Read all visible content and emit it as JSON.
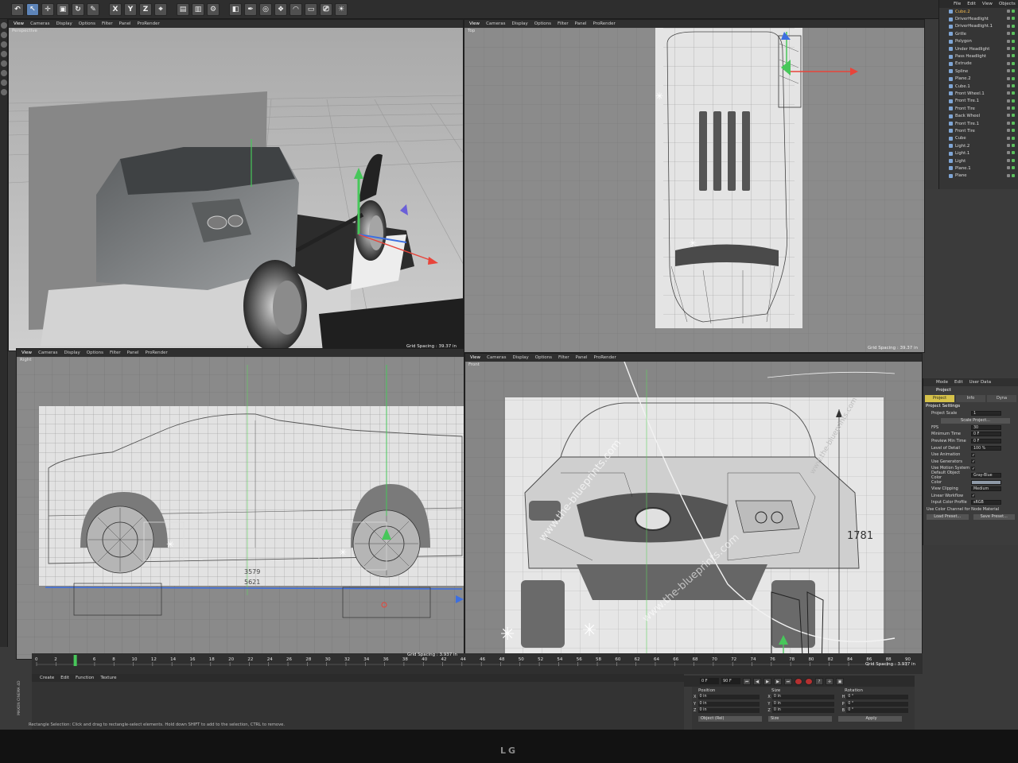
{
  "toolbar": {
    "axis_x": "X",
    "axis_y": "Y",
    "axis_z": "Z"
  },
  "viewports": {
    "perspective": {
      "menu": [
        "View",
        "Cameras",
        "Display",
        "Options",
        "Filter",
        "Panel",
        "ProRender"
      ],
      "name": "Perspective",
      "grid_spacing": "Grid Spacing : 39.37 in"
    },
    "top": {
      "menu": [
        "View",
        "Cameras",
        "Display",
        "Options",
        "Filter",
        "Panel",
        "ProRender"
      ],
      "name": "Top",
      "grid_spacing": "Grid Spacing : 39.37 in"
    },
    "right": {
      "menu": [
        "View",
        "Cameras",
        "Display",
        "Options",
        "Filter",
        "Panel",
        "ProRender"
      ],
      "name": "Right",
      "grid_spacing": "Grid Spacing : 3.937 in",
      "dim_1": "3579",
      "dim_2": "5621"
    },
    "front": {
      "menu": [
        "View",
        "Cameras",
        "Display",
        "Options",
        "Filter",
        "Panel",
        "ProRender"
      ],
      "name": "Front",
      "grid_spacing": "Grid Spacing : 3.937 in",
      "dim_height": "1781",
      "watermark": "www.the-blueprints.com"
    }
  },
  "object_manager": {
    "menu": [
      "File",
      "Edit",
      "View",
      "Objects"
    ],
    "objects": [
      {
        "name": "Cube.2",
        "selected": true
      },
      {
        "name": "DriverHeadlight",
        "selected": false
      },
      {
        "name": "DriverHeadlight.1",
        "selected": false
      },
      {
        "name": "Grille",
        "selected": false
      },
      {
        "name": "Polygon",
        "selected": false
      },
      {
        "name": "Under Headlight",
        "selected": false
      },
      {
        "name": "Pass Headlight",
        "selected": false
      },
      {
        "name": "Extrude",
        "selected": false
      },
      {
        "name": "Spline",
        "selected": false
      },
      {
        "name": "Plane.2",
        "selected": false
      },
      {
        "name": "Cube.1",
        "selected": false
      },
      {
        "name": "Front Wheel.1",
        "selected": false
      },
      {
        "name": "Front Tire.1",
        "selected": false
      },
      {
        "name": "Front Tire",
        "selected": false
      },
      {
        "name": "Back Wheel",
        "selected": false
      },
      {
        "name": "Front Tire.1",
        "selected": false
      },
      {
        "name": "Front Tire",
        "selected": false
      },
      {
        "name": "Cube",
        "selected": false
      },
      {
        "name": "Light.2",
        "selected": false
      },
      {
        "name": "Light.1",
        "selected": false
      },
      {
        "name": "Light",
        "selected": false
      },
      {
        "name": "Plane.1",
        "selected": false
      },
      {
        "name": "Plane",
        "selected": false
      }
    ]
  },
  "attributes": {
    "menu": [
      "Mode",
      "Edit",
      "User Data"
    ],
    "title": "Project",
    "tabs": [
      "Project Settings",
      "Info",
      "Dyna"
    ],
    "section": "Project Settings",
    "project_scale_label": "Project Scale",
    "project_scale_value": "1",
    "scale_button": "Scale Project...",
    "fps_label": "FPS",
    "fps_value": "30",
    "min_time_label": "Minimum Time",
    "min_time_value": "0 F",
    "preview_min_label": "Preview Min Time",
    "preview_min_value": "0 F",
    "lod_label": "Level of Detail",
    "lod_value": "100 %",
    "use_animation_label": "Use Animation",
    "use_generators_label": "Use Generators",
    "use_motion_label": "Use Motion System",
    "default_color_label": "Default Object Color",
    "default_color_value": "Gray-Blue",
    "color_label": "Color",
    "view_clipping_label": "View Clipping",
    "view_clipping_value": "Medium",
    "linear_workflow_label": "Linear Workflow",
    "input_color_label": "Input Color Profile",
    "input_color_value": "sRGB",
    "node_material_label": "Use Color Channel for Node Material",
    "load_preset": "Load Preset...",
    "save_preset": "Save Preset..."
  },
  "timeline": {
    "ticks": [
      "0",
      "2",
      "4",
      "6",
      "8",
      "10",
      "12",
      "14",
      "16",
      "18",
      "20",
      "22",
      "24",
      "26",
      "28",
      "30",
      "32",
      "34",
      "36",
      "38",
      "40",
      "42",
      "44",
      "46",
      "48",
      "50",
      "52",
      "54",
      "56",
      "58",
      "60",
      "62",
      "64",
      "66",
      "68",
      "70",
      "72",
      "74",
      "76",
      "78",
      "80",
      "82",
      "84",
      "86",
      "88",
      "90"
    ],
    "current_frame": "0 F",
    "end_frame": "90 F"
  },
  "material_manager": {
    "menu": [
      "Create",
      "Edit",
      "Function",
      "Texture"
    ]
  },
  "coordinates": {
    "headers": [
      "Position",
      "Size",
      "Rotation"
    ],
    "rows": [
      {
        "axis": "X",
        "pos": "0 in",
        "size": "0 in",
        "rot_axis": "H",
        "rot": "0 °"
      },
      {
        "axis": "Y",
        "pos": "0 in",
        "size": "0 in",
        "rot_axis": "P",
        "rot": "0 °"
      },
      {
        "axis": "Z",
        "pos": "0 in",
        "size": "0 in",
        "rot_axis": "B",
        "rot": "0 °"
      }
    ],
    "mode": "Object (Rel)",
    "size_mode": "Size",
    "apply": "Apply"
  },
  "status_text": "Rectangle Selection: Click and drag to rectangle-select elements. Hold down SHIFT to add to the selection, CTRL to remove.",
  "side_brand": "MAXON CINEMA 4D",
  "monitor_brand": "LG",
  "colors": {
    "x_axis": "#e8443a",
    "y_axis": "#47c75a",
    "z_axis": "#3d6fe0",
    "selection": "#f2b84b"
  }
}
